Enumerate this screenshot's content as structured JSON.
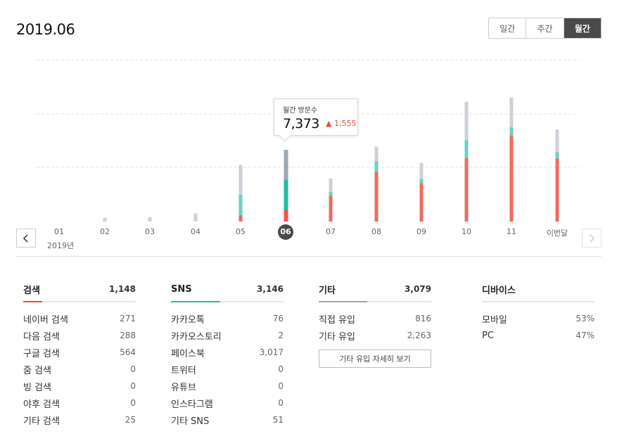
{
  "header": {
    "title": "2019.06",
    "tabs": [
      {
        "label": "일간",
        "active": false
      },
      {
        "label": "주간",
        "active": false
      },
      {
        "label": "월간",
        "active": true
      }
    ]
  },
  "nav": {
    "prev_icon": "chevron-left-icon",
    "next_icon": "chevron-right-icon"
  },
  "chart_data": {
    "type": "bar",
    "stacked": true,
    "categories": [
      "01",
      "02",
      "03",
      "04",
      "05",
      "06",
      "07",
      "08",
      "09",
      "10",
      "11",
      "이번달"
    ],
    "year_label": "2019년",
    "selected_index": 5,
    "series": [
      {
        "values": [
          0,
          0,
          0,
          0,
          1200,
          2200,
          4800,
          9200,
          7100,
          11800,
          16000,
          11700
        ],
        "color": "#f06b5d",
        "highlight_color": "#f0584a"
      },
      {
        "values": [
          0,
          0,
          0,
          0,
          3800,
          5600,
          700,
          2000,
          800,
          3300,
          1500,
          1200
        ],
        "color": "#69d2c3",
        "highlight_color": "#1ebea4"
      },
      {
        "values": [
          0,
          700,
          800,
          1500,
          5500,
          5500,
          2500,
          2700,
          3000,
          7100,
          5500,
          4200
        ],
        "color": "#ccd2d8",
        "highlight_color": "#9ea8b3"
      }
    ],
    "ylim": [
      0,
      30000
    ],
    "grid": true,
    "tooltip": {
      "label": "월간 방문수",
      "value": "7,373",
      "change": "▲ 1,555"
    }
  },
  "stats": [
    {
      "name": "검색",
      "total": "1,148",
      "accent": "#e94e3c",
      "accent_fraction": 0.17,
      "rows": [
        {
          "label": "네이버 검색",
          "value": "271"
        },
        {
          "label": "다음 검색",
          "value": "288"
        },
        {
          "label": "구글 검색",
          "value": "564"
        },
        {
          "label": "줌 검색",
          "value": "0"
        },
        {
          "label": "빙 검색",
          "value": "0"
        },
        {
          "label": "야후 검색",
          "value": "0"
        },
        {
          "label": "기타 검색",
          "value": "25"
        }
      ]
    },
    {
      "name": "SNS",
      "total": "3,146",
      "accent": "#1ebea4",
      "accent_fraction": 0.44,
      "rows": [
        {
          "label": "카카오톡",
          "value": "76"
        },
        {
          "label": "카카오스토리",
          "value": "2"
        },
        {
          "label": "페이스북",
          "value": "3,017"
        },
        {
          "label": "트위터",
          "value": "0"
        },
        {
          "label": "유튜브",
          "value": "0"
        },
        {
          "label": "인스타그램",
          "value": "0"
        },
        {
          "label": "기타 SNS",
          "value": "51"
        }
      ]
    },
    {
      "name": "기타",
      "total": "3,079",
      "accent": "#9ea8b3",
      "accent_fraction": 0.43,
      "rows": [
        {
          "label": "직접 유입",
          "value": "816"
        },
        {
          "label": "기타 유입",
          "value": "2,263"
        }
      ],
      "button": "기타 유입 자세히 보기"
    },
    {
      "name": "디바이스",
      "total": "",
      "accent": "#e6e6e6",
      "accent_fraction": 0,
      "rows": [
        {
          "label": "모바일",
          "value": "53%"
        },
        {
          "label": "PC",
          "value": "47%"
        }
      ]
    }
  ]
}
